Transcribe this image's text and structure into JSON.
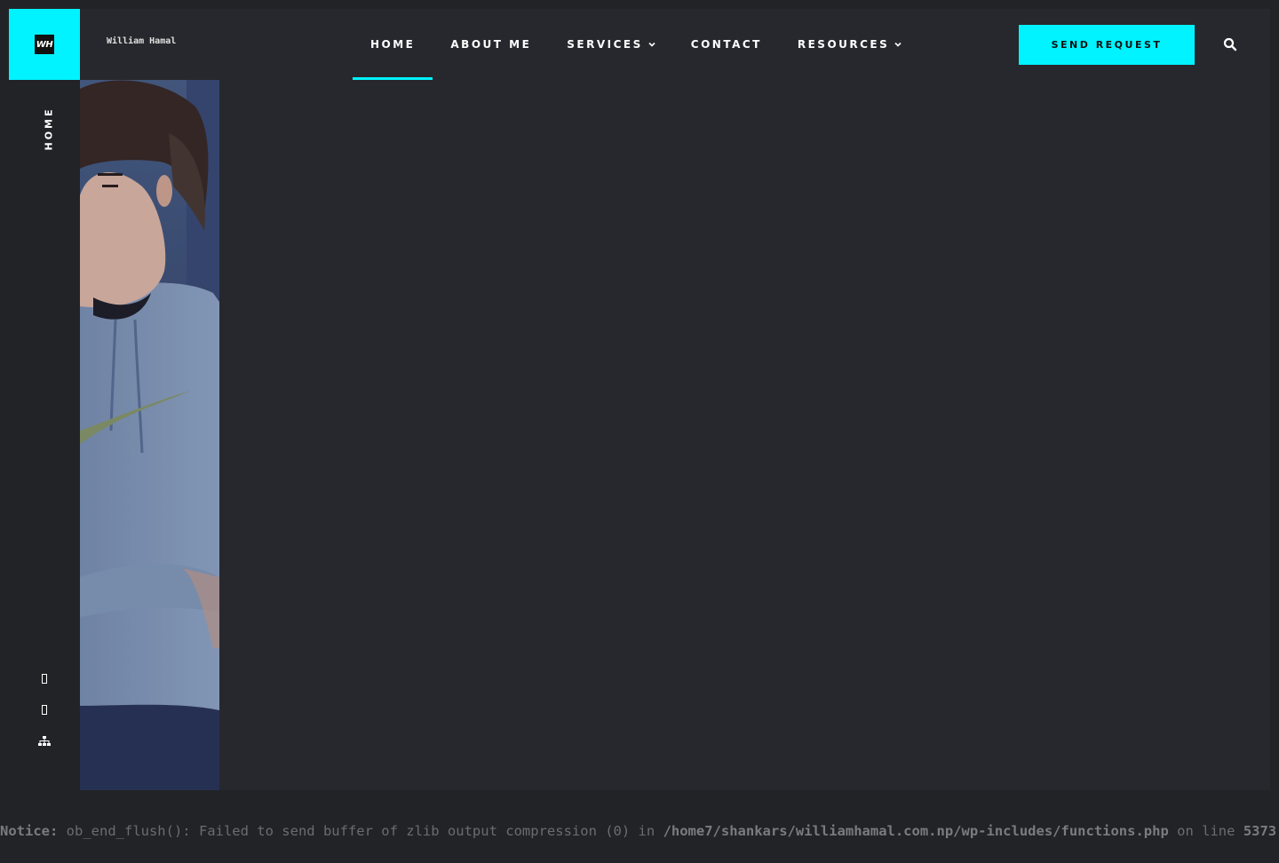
{
  "brand": {
    "logo_text": "WH",
    "site_name": "William Hamal"
  },
  "sidebar": {
    "vertical_label": "HOME",
    "icons": [
      "facebook-icon",
      "linkedin-icon",
      "sitemap-icon"
    ]
  },
  "nav": {
    "items": [
      {
        "label": "HOME",
        "active": true,
        "dropdown": false
      },
      {
        "label": "ABOUT ME",
        "active": false,
        "dropdown": false
      },
      {
        "label": "SERVICES",
        "active": false,
        "dropdown": true
      },
      {
        "label": "CONTACT",
        "active": false,
        "dropdown": false
      },
      {
        "label": "RESOURCES",
        "active": false,
        "dropdown": true
      }
    ]
  },
  "cta": {
    "label": "SEND REQUEST"
  },
  "search": {
    "icon": "search-icon"
  },
  "notice": {
    "label": "Notice:",
    "message": " ob_end_flush(): Failed to send buffer of zlib output compression (0) in ",
    "path": "/home7/shankars/williamhamal.com.np/wp-includes/functions.php",
    "on_line": " on line ",
    "line_number": "5373"
  },
  "colors": {
    "accent": "#00f3ff",
    "background": "#222327",
    "panel": "#27282d"
  }
}
